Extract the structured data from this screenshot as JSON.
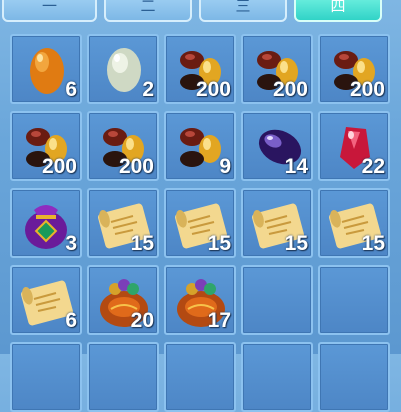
{
  "tabs": [
    {
      "label": "一",
      "active": false
    },
    {
      "label": "二",
      "active": false
    },
    {
      "label": "三",
      "active": false
    },
    {
      "label": "四",
      "active": true
    }
  ],
  "items": [
    {
      "icon": "orange-egg-icon",
      "count": "6"
    },
    {
      "icon": "white-egg-icon",
      "count": "2"
    },
    {
      "icon": "beans-icon",
      "count": "200"
    },
    {
      "icon": "beans-icon",
      "count": "200"
    },
    {
      "icon": "beans-icon",
      "count": "200"
    },
    {
      "icon": "beans-icon",
      "count": "200"
    },
    {
      "icon": "beans-icon",
      "count": "200"
    },
    {
      "icon": "beans-icon",
      "count": "9"
    },
    {
      "icon": "purple-gem-icon",
      "count": "14"
    },
    {
      "icon": "red-gem-icon",
      "count": "22"
    },
    {
      "icon": "pouch-icon",
      "count": "3"
    },
    {
      "icon": "scroll-icon",
      "count": "15"
    },
    {
      "icon": "scroll-icon",
      "count": "15"
    },
    {
      "icon": "scroll-icon",
      "count": "15"
    },
    {
      "icon": "scroll-icon",
      "count": "15"
    },
    {
      "icon": "scroll-icon",
      "count": "6"
    },
    {
      "icon": "treasure-sack-icon",
      "count": "20"
    },
    {
      "icon": "treasure-sack-icon",
      "count": "17"
    }
  ],
  "colors": {
    "active_tab": "#31d3c7",
    "slot": "#5b98d6",
    "slot_border": "#8cc2ef"
  }
}
